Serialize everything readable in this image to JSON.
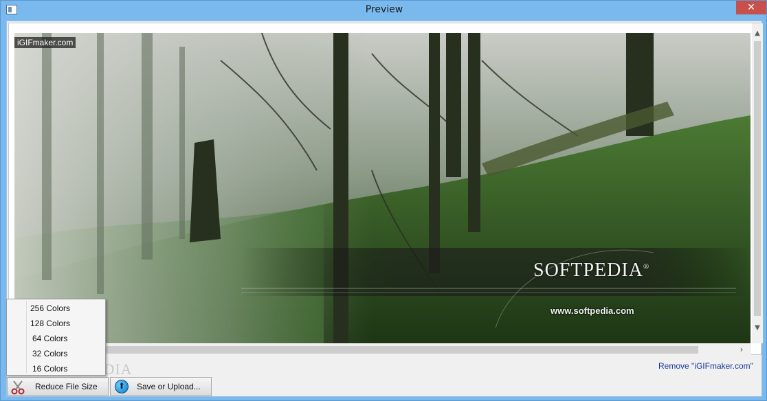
{
  "window": {
    "title": "Preview",
    "close_glyph": "✕"
  },
  "image": {
    "watermark": "iGIFmaker.com",
    "logo_text": "SOFTPEDIA",
    "registered_mark": "®",
    "url_text": "www.softpedia.com"
  },
  "remove_link": "Remove \"iGIFmaker.com\"",
  "buttons": {
    "reduce": "Reduce File Size",
    "save": "Save or Upload..."
  },
  "reduce_menu": {
    "items": [
      "256 Colors",
      "128 Colors",
      "64 Colors",
      "32 Colors",
      "16 Colors"
    ]
  },
  "background_watermark": "SOFTPEDIA",
  "icons": {
    "app": "window-icon",
    "reduce": "scissors-icon",
    "save": "upload-arrow-icon"
  },
  "colors": {
    "title_bar": "#79b9ee",
    "close_button": "#c7504d",
    "link": "#1a3a9c"
  }
}
